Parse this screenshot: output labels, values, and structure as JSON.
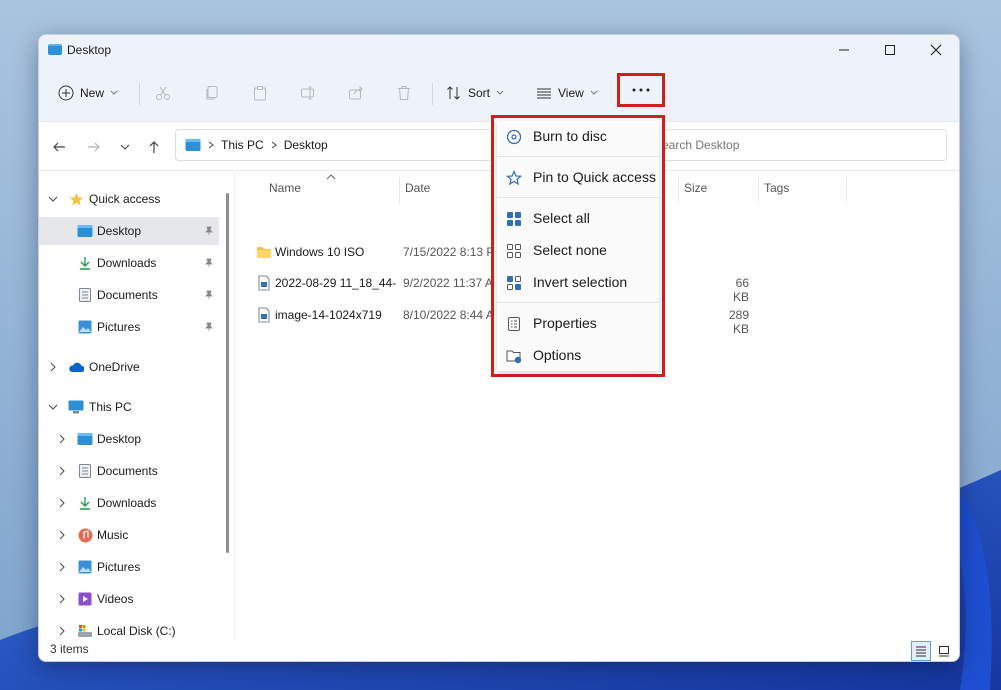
{
  "window": {
    "title": "Desktop"
  },
  "toolbar": {
    "new_label": "New",
    "sort_label": "Sort",
    "view_label": "View",
    "more_glyph": "···"
  },
  "address": {
    "segments": [
      "This PC",
      "Desktop"
    ],
    "search_placeholder": "earch Desktop"
  },
  "sidebar": {
    "quick_access": "Quick access",
    "quick_items": [
      "Desktop",
      "Downloads",
      "Documents",
      "Pictures"
    ],
    "onedrive": "OneDrive",
    "this_pc": "This PC",
    "pc_items": [
      "Desktop",
      "Documents",
      "Downloads",
      "Music",
      "Pictures",
      "Videos",
      "Local Disk (C:)"
    ]
  },
  "columns": {
    "name": "Name",
    "date": "Date",
    "size": "Size",
    "tags": "Tags"
  },
  "files": [
    {
      "name": "Windows 10 ISO",
      "date": "7/15/2022 8:13 P",
      "size": "",
      "icon": "folder-icon"
    },
    {
      "name": "2022-08-29 11_18_44-",
      "date": "9/2/2022 11:37 A",
      "size": "66 KB",
      "icon": "image-file-icon"
    },
    {
      "name": "image-14-1024x719",
      "date": "8/10/2022 8:44 A",
      "size": "289 KB",
      "icon": "image-file-icon"
    }
  ],
  "menu": {
    "burn": "Burn to disc",
    "pin": "Pin to Quick access",
    "select_all": "Select all",
    "select_none": "Select none",
    "invert": "Invert selection",
    "properties": "Properties",
    "options": "Options"
  },
  "status": {
    "items": "3 items"
  },
  "colors": {
    "highlight": "#d0201c",
    "accent": "#0067c0",
    "folder": "#f5c242"
  }
}
